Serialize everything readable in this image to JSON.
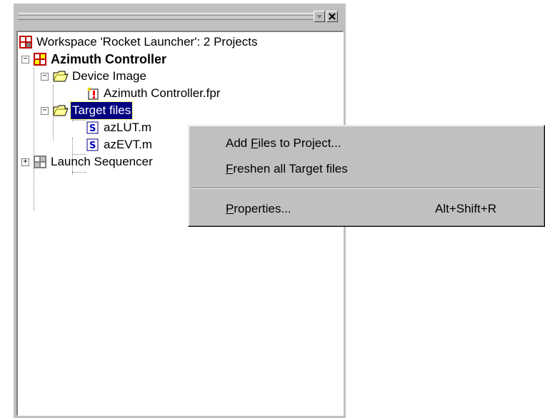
{
  "pane": {
    "restore_icon": "restore-icon",
    "close_icon": "close-icon"
  },
  "tree": {
    "workspace": "Workspace 'Rocket Launcher': 2 Projects",
    "project1": "Azimuth Controller",
    "folder_device": "Device Image",
    "file_fpr": "Azimuth Controller.fpr",
    "folder_target": "Target files",
    "file_lut": "azLUT.m",
    "file_evt": "azEVT.m",
    "project2": "Launch Sequencer",
    "expander_open": "−",
    "expander_closed": "+"
  },
  "context_menu": {
    "add_files": {
      "prefix": "Add ",
      "accel": "F",
      "suffix": "iles to Project..."
    },
    "freshen": {
      "prefix": "",
      "accel": "F",
      "suffix": "reshen all Target files"
    },
    "properties": {
      "prefix": "",
      "accel": "P",
      "suffix": "roperties...",
      "shortcut": "Alt+Shift+R"
    }
  },
  "colors": {
    "selection": "#000080",
    "face": "#c0c0c0"
  }
}
